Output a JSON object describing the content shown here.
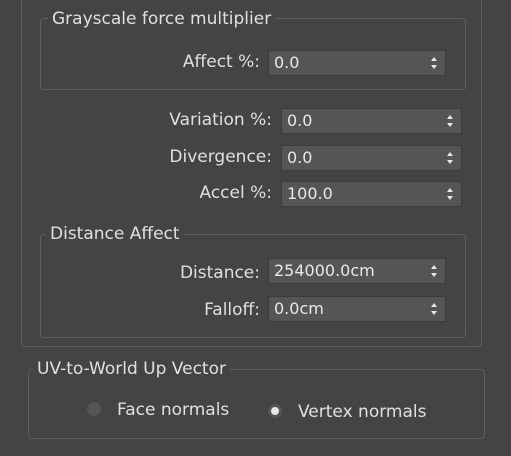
{
  "grayscale_group": {
    "title": "Grayscale force multiplier",
    "affect_label": "Affect %:",
    "affect_value": "0.0"
  },
  "fields": {
    "variation_label": "Variation %:",
    "variation_value": "0.0",
    "divergence_label": "Divergence:",
    "divergence_value": "0.0",
    "accel_label": "Accel %:",
    "accel_value": "100.0"
  },
  "distance_group": {
    "title": "Distance Affect",
    "distance_label": "Distance:",
    "distance_value": "254000.0cm",
    "falloff_label": "Falloff:",
    "falloff_value": "0.0cm"
  },
  "uv_group": {
    "title": "UV-to-World Up Vector",
    "options": [
      {
        "label": "Face normals",
        "selected": false
      },
      {
        "label": "Vertex normals",
        "selected": true
      }
    ]
  },
  "colors": {
    "background": "#444444",
    "field": "#555555",
    "text": "#e0e0e0"
  },
  "icons": {
    "spinner": "up-down-arrows-icon"
  }
}
